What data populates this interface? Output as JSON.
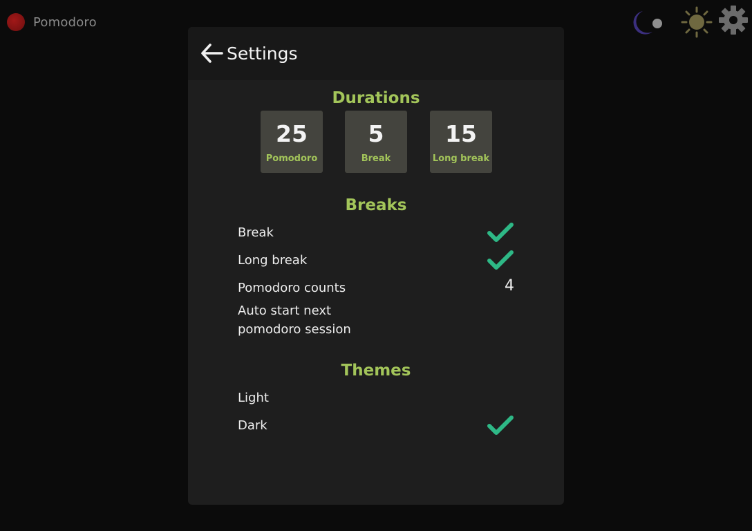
{
  "app": {
    "name": "Pomodoro"
  },
  "top_icons": [
    {
      "name": "moon-toggle-icon"
    },
    {
      "name": "sun-icon"
    },
    {
      "name": "gear-icon"
    }
  ],
  "settings": {
    "title": "Settings",
    "durations": {
      "heading": "Durations",
      "items": [
        {
          "value": "25",
          "label": "Pomodoro"
        },
        {
          "value": "5",
          "label": "Break"
        },
        {
          "value": "15",
          "label": "Long break"
        }
      ]
    },
    "breaks": {
      "heading": "Breaks",
      "break_label": "Break",
      "break_enabled": true,
      "long_break_label": "Long break",
      "long_break_enabled": true,
      "pomodoro_counts_label": "Pomodoro counts",
      "pomodoro_counts_value": "4",
      "auto_start_label_line1": "Auto start next",
      "auto_start_label_line2": "pomodoro session",
      "auto_start_enabled": false
    },
    "themes": {
      "heading": "Themes",
      "options": [
        {
          "label": "Light",
          "selected": false
        },
        {
          "label": "Dark",
          "selected": true
        }
      ]
    }
  },
  "colors": {
    "accent": "#a3c55a",
    "check": "#2eb886",
    "card_bg": "#1e1e1e",
    "page_bg": "#0b0b0b"
  }
}
